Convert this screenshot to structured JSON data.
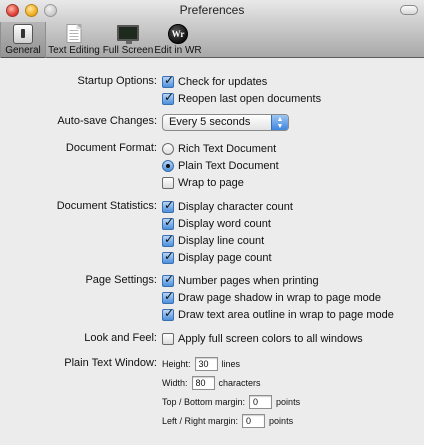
{
  "window": {
    "title": "Preferences"
  },
  "toolbar": {
    "items": [
      {
        "label": "General",
        "icon": "general-switch-icon",
        "selected": true
      },
      {
        "label": "Text Editing",
        "icon": "document-icon",
        "selected": false
      },
      {
        "label": "Full Screen",
        "icon": "monitor-icon",
        "selected": false
      },
      {
        "label": "Edit in WR",
        "icon": "wr-icon",
        "selected": false,
        "icon_text": "Wr"
      }
    ]
  },
  "startup": {
    "label": "Startup Options:",
    "check_updates": {
      "label": "Check for updates",
      "checked": true
    },
    "reopen_docs": {
      "label": "Reopen last open documents",
      "checked": true
    }
  },
  "autosave": {
    "label": "Auto-save Changes:",
    "value": "Every 5 seconds"
  },
  "doc_format": {
    "label": "Document Format:",
    "rich": {
      "label": "Rich Text Document",
      "selected": false
    },
    "plain": {
      "label": "Plain Text Document",
      "selected": true
    },
    "wrap": {
      "label": "Wrap to page",
      "checked": false
    }
  },
  "doc_stats": {
    "label": "Document Statistics:",
    "items": [
      {
        "label": "Display character count",
        "checked": true
      },
      {
        "label": "Display word count",
        "checked": true
      },
      {
        "label": "Display line count",
        "checked": true
      },
      {
        "label": "Display page count",
        "checked": true
      }
    ]
  },
  "page_settings": {
    "label": "Page Settings:",
    "items": [
      {
        "label": "Number pages when printing",
        "checked": true
      },
      {
        "label": "Draw page shadow in wrap to page mode",
        "checked": true
      },
      {
        "label": "Draw text area outline in wrap to page mode",
        "checked": true
      }
    ]
  },
  "look_feel": {
    "label": "Look and Feel:",
    "fullscreen_colors": {
      "label": "Apply full screen colors to all windows",
      "checked": false
    }
  },
  "plain_window": {
    "label": "Plain Text Window:",
    "height": {
      "label": "Height:",
      "value": "30",
      "unit": "lines"
    },
    "width": {
      "label": "Width:",
      "value": "80",
      "unit": "characters"
    },
    "tb_margin": {
      "label": "Top / Bottom margin:",
      "value": "0",
      "unit": "points"
    },
    "lr_margin": {
      "label": "Left / Right margin:",
      "value": "0",
      "unit": "points"
    }
  }
}
